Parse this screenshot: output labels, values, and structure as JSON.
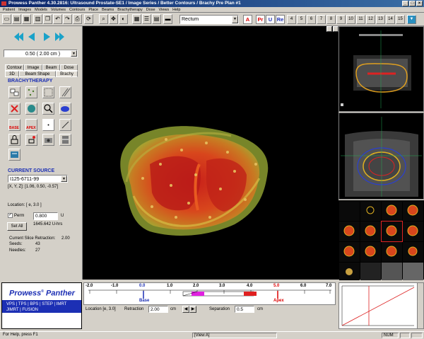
{
  "title": "Prowess Panther 4.30.2816: Ultrasound Prostate-SE1 / Image Series / Better Contours / Brachy Pre Plan #1",
  "menu": [
    "Patient",
    "Images",
    "Models",
    "Volumes",
    "Contours",
    "Place",
    "Beams",
    "Brachytherapy",
    "Dose",
    "Views",
    "Help"
  ],
  "toolbar": {
    "view_select": "Rectum",
    "pill_a": "A",
    "pill_pr": "Pr",
    "pill_u": "U",
    "pill_re": "Re",
    "numbers": [
      "4",
      "5",
      "6",
      "7",
      "8",
      "9",
      "10",
      "11",
      "12",
      "13",
      "14",
      "15"
    ]
  },
  "left": {
    "step_select": "0.50 (  2.00 cm )",
    "tabs_row1": [
      "Contour",
      "Image",
      "Beam",
      "Dose"
    ],
    "tabs_row2": [
      "3D",
      "Beam Shape",
      "Brachy"
    ],
    "section_title": "BRACHYTHERAPY",
    "base_label": "BASE",
    "apex_label": "APEX",
    "current_source_title": "CURRENT SOURCE",
    "source_select": "I125-6711-99",
    "xyz_label": "[X,  Y,  Z]: [1.06, 0.50, -0.57]",
    "location_label": "Location:  [ e, 3.0 ]",
    "perm_label": "Perm",
    "perm_value": "0.800",
    "perm_unit": "U",
    "uhrs_label": "1645.642 U-hrs",
    "set_all": "Set All",
    "retraction_label": "Current Slice Retraction:",
    "retraction_value": "2.00",
    "seeds_label": "Seeds:",
    "seeds_value": "43",
    "needles_label": "Needles:",
    "needles_value": "27"
  },
  "logo": {
    "name": "Prowess",
    "reg": "®",
    "name2": "Panther",
    "line1": "VPS | TPS | BPS | STEP | IMRT",
    "line2": "JIMRT | FUSION"
  },
  "ruler": {
    "ticks": [
      "-2.0",
      "-1.0",
      "0.0",
      "1.0",
      "2.0",
      "3.0",
      "4.0",
      "5.0",
      "6.0",
      "7.0"
    ],
    "base": "Base",
    "apex": "Apex"
  },
  "bottom_controls": {
    "location": "Location  [e,  3.0]",
    "retraction": "Retraction",
    "retraction_value": "2.00",
    "retraction_unit": "cm",
    "separation": "Separation",
    "separation_value": "0.5",
    "separation_unit": "cm"
  },
  "status": {
    "help": "For Help, press F1",
    "view": "[View A]",
    "num": "NUM"
  },
  "colors": {
    "accent": "#1c2fb4",
    "prostate_red": "#d23a1e",
    "contour_yellow": "#d8c84a"
  }
}
